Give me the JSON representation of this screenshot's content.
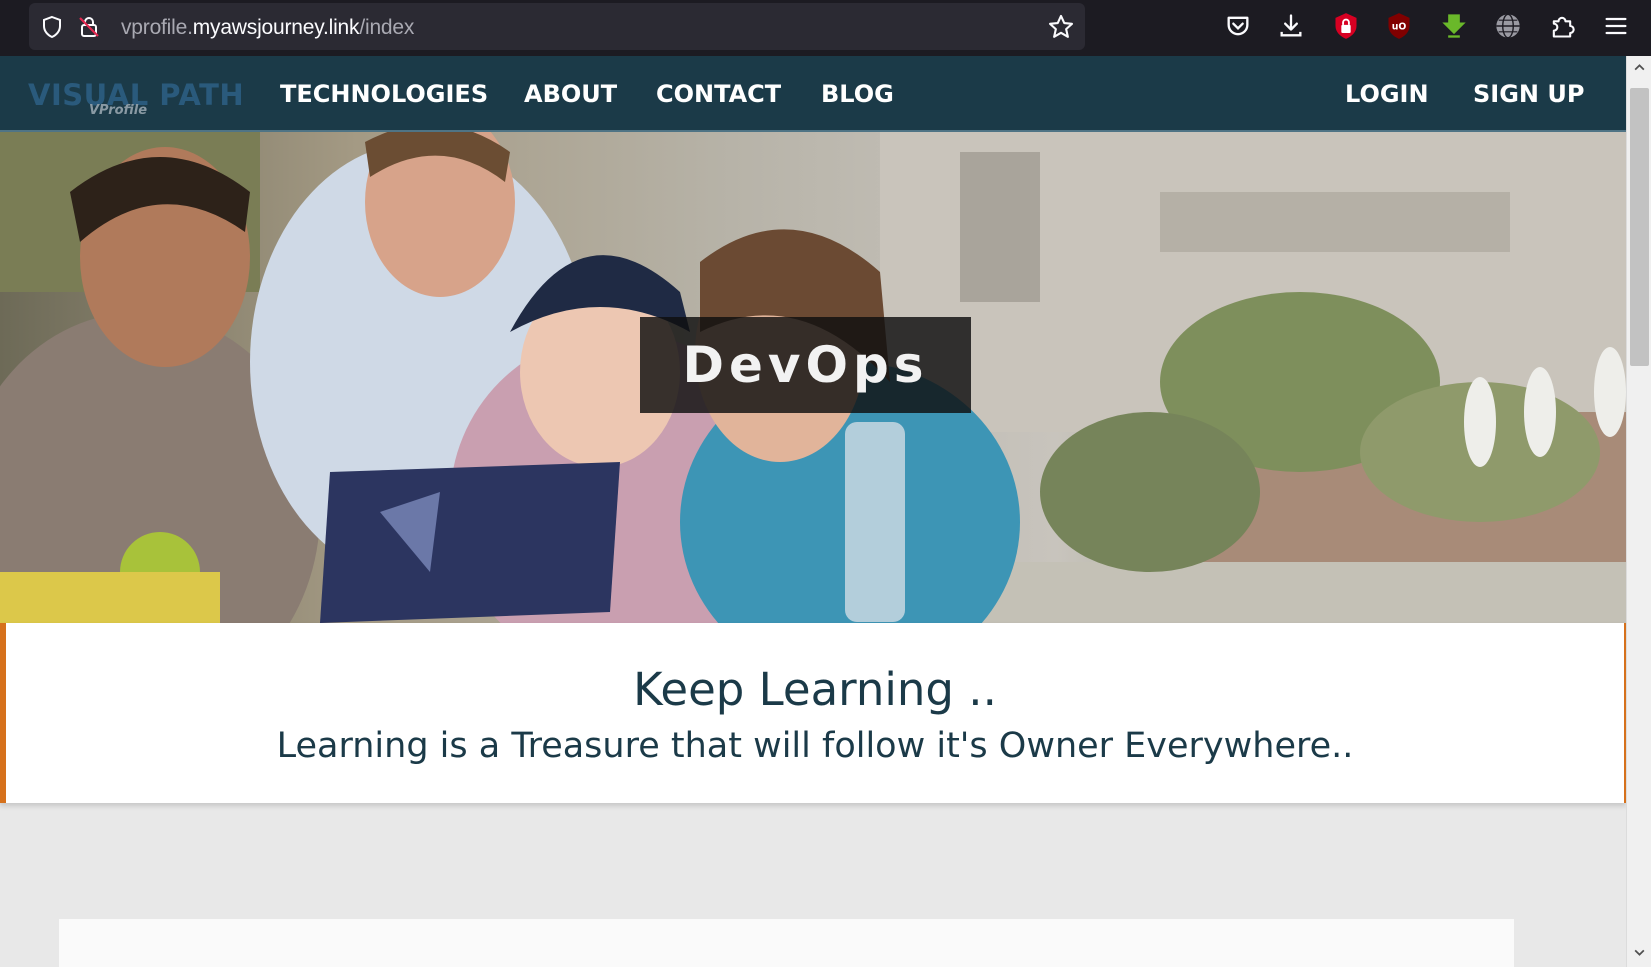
{
  "browser": {
    "url_host_prefix": "vprofile.",
    "url_domain": "myawsjourney.link",
    "url_path": "/index"
  },
  "site": {
    "brand": "VISUAL PATH",
    "brand_sub": "VProfile",
    "nav": [
      "TECHNOLOGIES",
      "ABOUT",
      "CONTACT",
      "BLOG"
    ],
    "login": "LOGIN",
    "signup": "SIGN UP"
  },
  "hero": {
    "caption": "DevOps"
  },
  "quote": {
    "title": "Keep Learning ..",
    "text": "Learning is a Treasure that will follow it's Owner Everywhere.."
  },
  "colors": {
    "nav_bg": "#1b3a48",
    "accent_border": "#d6711c",
    "text_dark": "#1b3a48"
  },
  "icons": {
    "url_left": [
      "shield-icon",
      "insecure-lock-icon"
    ],
    "url_right": [
      "bookmark-star-icon"
    ],
    "toolbar": [
      "pocket-icon",
      "download-icon",
      "password-lock-extension-icon",
      "ublock-origin-icon",
      "download-arrow-extension-icon",
      "globe-icon",
      "extensions-puzzle-icon",
      "hamburger-menu-icon"
    ]
  }
}
